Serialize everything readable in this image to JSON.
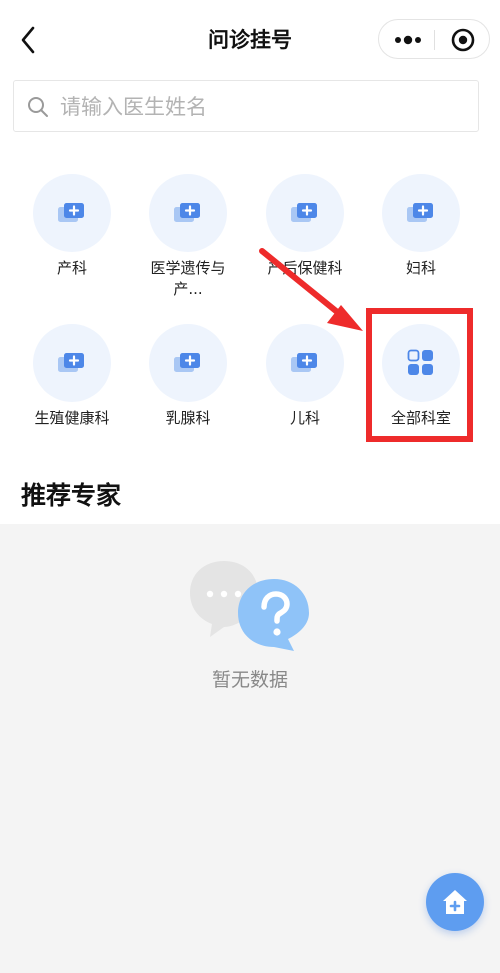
{
  "header": {
    "title": "问诊挂号",
    "back_label": "返回"
  },
  "search": {
    "placeholder": "请输入医生姓名",
    "value": ""
  },
  "departments": [
    {
      "label": "产科",
      "icon": "department-icon"
    },
    {
      "label": "医学遗传与产前诊断",
      "display": "医学遗传与产...",
      "icon": "department-icon"
    },
    {
      "label": "产后保健科",
      "icon": "department-icon"
    },
    {
      "label": "妇科",
      "icon": "department-icon"
    },
    {
      "label": "生殖健康科",
      "icon": "department-icon"
    },
    {
      "label": "乳腺科",
      "icon": "department-icon"
    },
    {
      "label": "儿科",
      "icon": "department-icon"
    },
    {
      "label": "全部科室",
      "icon": "grid-icon"
    }
  ],
  "section": {
    "title": "推荐专家"
  },
  "empty": {
    "text": "暂无数据"
  },
  "colors": {
    "accent": "#5e9df0",
    "highlight": "#ee2b2b",
    "circle_bg": "#eef4fd"
  }
}
